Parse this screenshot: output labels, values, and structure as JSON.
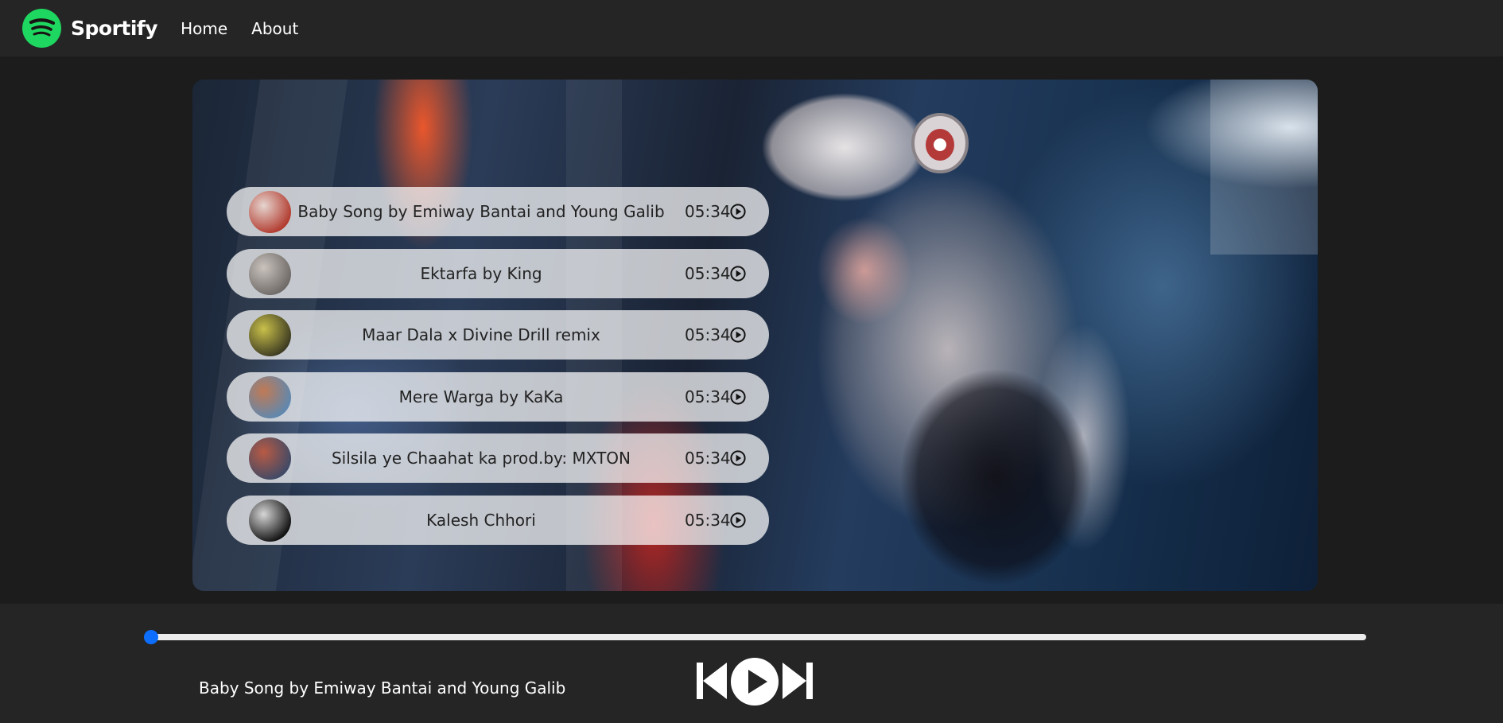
{
  "navbar": {
    "brand": "Sportify",
    "links": [
      "Home",
      "About"
    ],
    "logo_icon": "spotify-logo-icon",
    "accent_color": "#1ed760"
  },
  "playlist": {
    "songs": [
      {
        "title": "Baby Song by Emiway Bantai and Young Galib",
        "duration": "05:34",
        "thumb_colors": [
          "#b23a2e",
          "#e5d5cf"
        ]
      },
      {
        "title": "Ektarfa by King",
        "duration": "05:34",
        "thumb_colors": [
          "#6f6a67",
          "#c9c2bd"
        ]
      },
      {
        "title": "Maar Dala x Divine Drill remix",
        "duration": "05:34",
        "thumb_colors": [
          "#3d3b22",
          "#c9c04a"
        ]
      },
      {
        "title": "Mere Warga by KaKa",
        "duration": "05:34",
        "thumb_colors": [
          "#5e88b0",
          "#c07a55"
        ]
      },
      {
        "title": "Silsila ye Chaahat ka prod.by: MXTON",
        "duration": "05:34",
        "thumb_colors": [
          "#3f4a66",
          "#b85a44"
        ]
      },
      {
        "title": "Kalesh Chhori",
        "duration": "05:34",
        "thumb_colors": [
          "#111111",
          "#d6d6d6"
        ]
      }
    ],
    "play_icon": "play-circle-icon"
  },
  "player": {
    "now_playing": "Baby Song by Emiway Bantai and Young Galib",
    "progress": 0,
    "progress_color": "#0d6efd",
    "controls": [
      "previous-icon",
      "play-circle-icon",
      "next-icon"
    ]
  }
}
